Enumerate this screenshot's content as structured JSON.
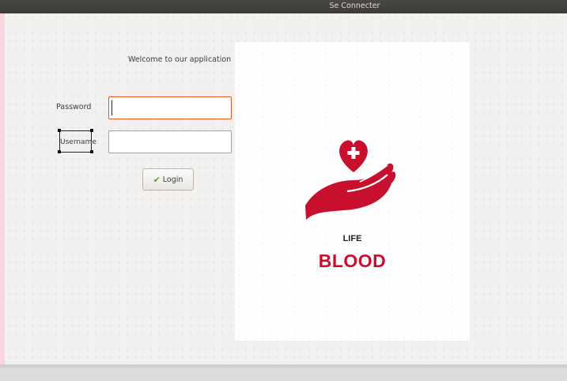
{
  "window": {
    "title": "Se Connecter"
  },
  "form": {
    "welcome_text": "Welcome to our application",
    "password_label": "Password",
    "password_value": "",
    "username_label": "Username",
    "username_value": "",
    "login_label": "Login"
  },
  "logo": {
    "line1": "LIFE",
    "line2": "BLOOD",
    "brand_color": "#c8102e",
    "icon": "heart-hand-icon"
  },
  "colors": {
    "titlebar": "#3c3b37",
    "focus_border": "#e25a22",
    "check": "#5aa428"
  }
}
